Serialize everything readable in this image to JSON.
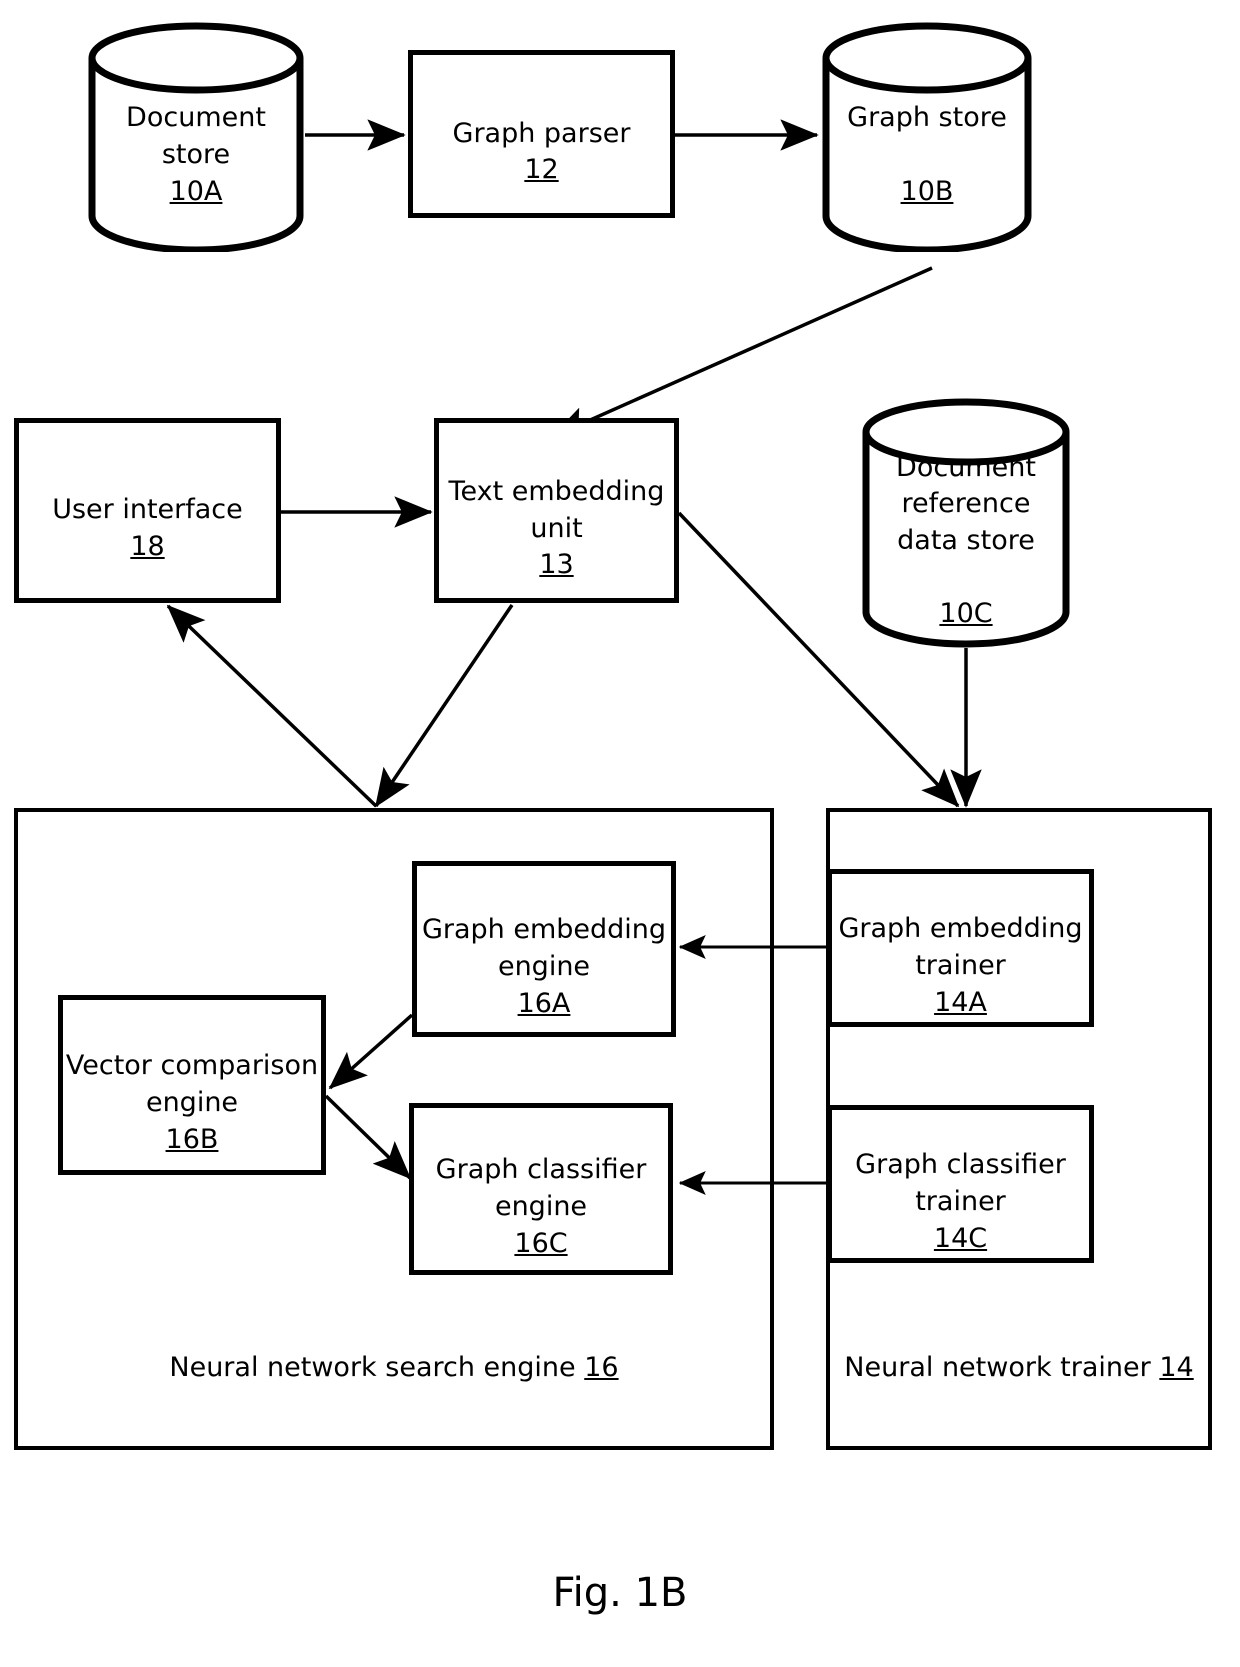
{
  "figure": {
    "caption": "Fig. 1B"
  },
  "nodes": {
    "document_store": {
      "name": "Document store",
      "ref": "10A",
      "shape": "cylinder"
    },
    "graph_parser": {
      "name": "Graph parser",
      "ref": "12",
      "shape": "rect"
    },
    "graph_store": {
      "name": "Graph store",
      "ref": "10B",
      "shape": "cylinder"
    },
    "user_interface": {
      "name": "User interface",
      "ref": "18",
      "shape": "rect"
    },
    "text_embedding_unit": {
      "name": "Text embedding unit",
      "ref": "13",
      "shape": "rect"
    },
    "document_reference_data_store": {
      "name": "Document reference data store",
      "ref": "10C",
      "shape": "cylinder"
    },
    "neural_network_search_engine": {
      "name": "Neural network search engine",
      "ref": "16",
      "shape": "container"
    },
    "neural_network_trainer": {
      "name": "Neural network trainer",
      "ref": "14",
      "shape": "container"
    },
    "graph_embedding_engine": {
      "name": "Graph embedding engine",
      "ref": "16A",
      "shape": "rect"
    },
    "vector_comparison_engine": {
      "name": "Vector comparison engine",
      "ref": "16B",
      "shape": "rect"
    },
    "graph_classifier_engine": {
      "name": "Graph classifier engine",
      "ref": "16C",
      "shape": "rect"
    },
    "graph_embedding_trainer": {
      "name": "Graph embedding trainer",
      "ref": "14A",
      "shape": "rect"
    },
    "graph_classifier_trainer": {
      "name": "Graph classifier trainer",
      "ref": "14C",
      "shape": "rect"
    }
  },
  "edges": [
    {
      "from": "document_store",
      "to": "graph_parser",
      "arrow": "single"
    },
    {
      "from": "graph_parser",
      "to": "graph_store",
      "arrow": "single"
    },
    {
      "from": "graph_store",
      "to": "text_embedding_unit",
      "arrow": "single"
    },
    {
      "from": "user_interface",
      "to": "text_embedding_unit",
      "arrow": "single"
    },
    {
      "from": "text_embedding_unit",
      "to": "neural_network_search_engine",
      "arrow": "single"
    },
    {
      "from": "neural_network_search_engine",
      "to": "user_interface",
      "arrow": "single"
    },
    {
      "from": "text_embedding_unit",
      "to": "neural_network_trainer",
      "arrow": "single"
    },
    {
      "from": "document_reference_data_store",
      "to": "neural_network_trainer",
      "arrow": "single"
    },
    {
      "from": "graph_embedding_trainer",
      "to": "graph_embedding_engine",
      "arrow": "single"
    },
    {
      "from": "graph_classifier_trainer",
      "to": "graph_classifier_engine",
      "arrow": "single"
    },
    {
      "from": "graph_embedding_engine",
      "to": "vector_comparison_engine",
      "arrow": "single"
    },
    {
      "from": "vector_comparison_engine",
      "to": "graph_classifier_engine",
      "arrow": "single"
    }
  ],
  "colors": {
    "stroke": "#000000",
    "background": "#ffffff",
    "text": "#000000"
  }
}
